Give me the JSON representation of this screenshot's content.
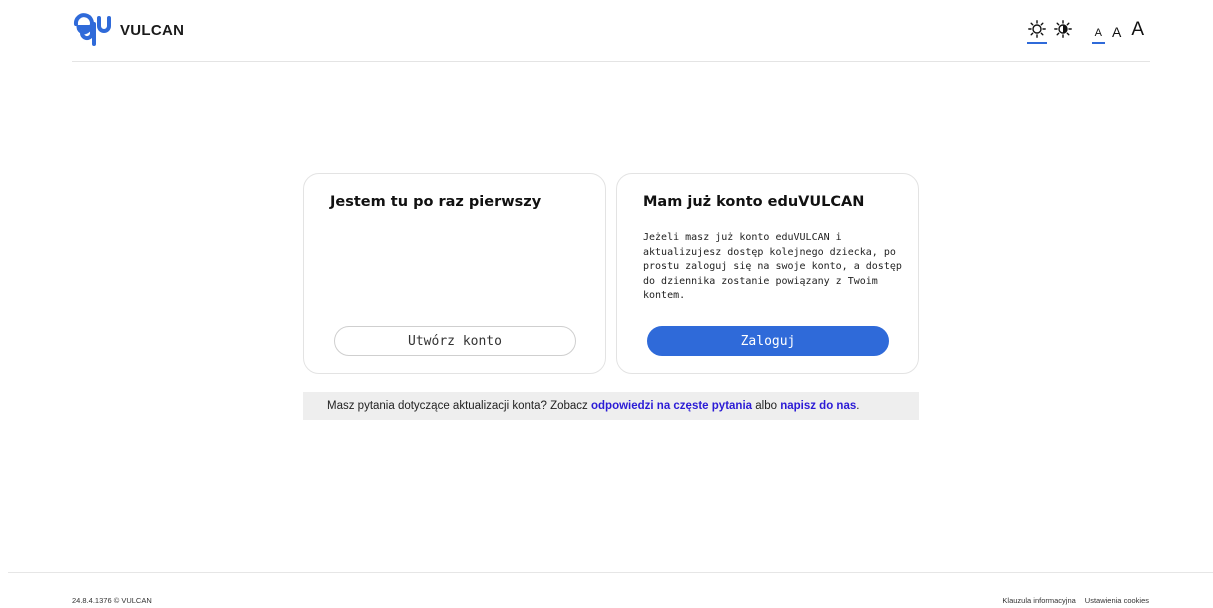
{
  "header": {
    "logo_text": "VULCAN",
    "brand_color": "#2f6ad9",
    "contrast": {
      "normal_icon": "sun-icon",
      "high_icon": "contrast-sun-icon",
      "active": "normal"
    },
    "font_sizes": [
      "A",
      "A",
      "A"
    ],
    "active_font_size": "small"
  },
  "cards": {
    "new_user": {
      "title": "Jestem tu po raz pierwszy",
      "button_label": "Utwórz konto"
    },
    "existing_user": {
      "title": "Mam już konto eduVULCAN",
      "text": "Jeżeli masz już konto eduVULCAN i aktualizujesz dostęp kolejnego dziecka, po prostu zaloguj się na swoje konto, a dostęp do dziennika zostanie powiązany z Twoim kontem.",
      "button_label": "Zaloguj"
    }
  },
  "info_bar": {
    "text_before": "Masz pytania dotyczące aktualizacji konta? Zobacz ",
    "faq_link": "odpowiedzi na częste pytania",
    "text_middle": " albo ",
    "contact_link": "napisz do nas",
    "text_after": ".",
    "link_color": "#2b1bd6"
  },
  "footer": {
    "version": "24.8.4.1376 © VULCAN",
    "links": [
      "Klauzula informacyjna",
      "Ustawienia cookies"
    ]
  }
}
